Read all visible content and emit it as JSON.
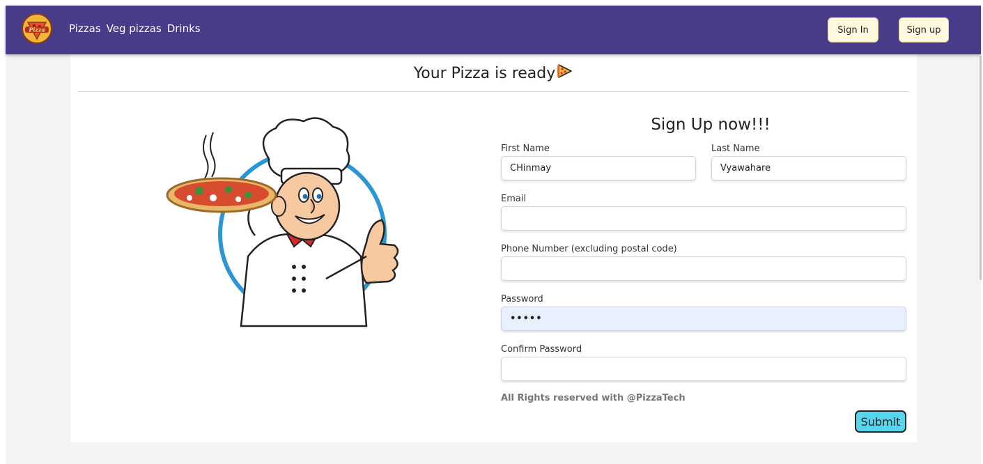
{
  "brand": {
    "logo_icon": "pizza-logo-icon",
    "accent": "#483c8a"
  },
  "nav": {
    "links": [
      "Pizzas",
      "Veg pizzas",
      "Drinks"
    ],
    "signin_label": "Sign In",
    "signup_label": "Sign up"
  },
  "card": {
    "title": "Your Pizza is ready",
    "title_icon": "pizza-slice-icon",
    "image": "chef-holding-pizza-illustration"
  },
  "form": {
    "title": "Sign Up now!!!",
    "first_name": {
      "label": "First Name",
      "value": "CHinmay"
    },
    "last_name": {
      "label": "Last Name",
      "value": "Vyawahare"
    },
    "email": {
      "label": "Email",
      "value": ""
    },
    "phone": {
      "label": "Phone Number (excluding postal code)",
      "value": ""
    },
    "password": {
      "label": "Password",
      "value": "•••••"
    },
    "confirm_password": {
      "label": "Confirm Password",
      "value": ""
    },
    "footer_note": "All Rights reserved with @PizzaTech",
    "submit_label": "Submit",
    "submit_color": "#56d6ee"
  }
}
